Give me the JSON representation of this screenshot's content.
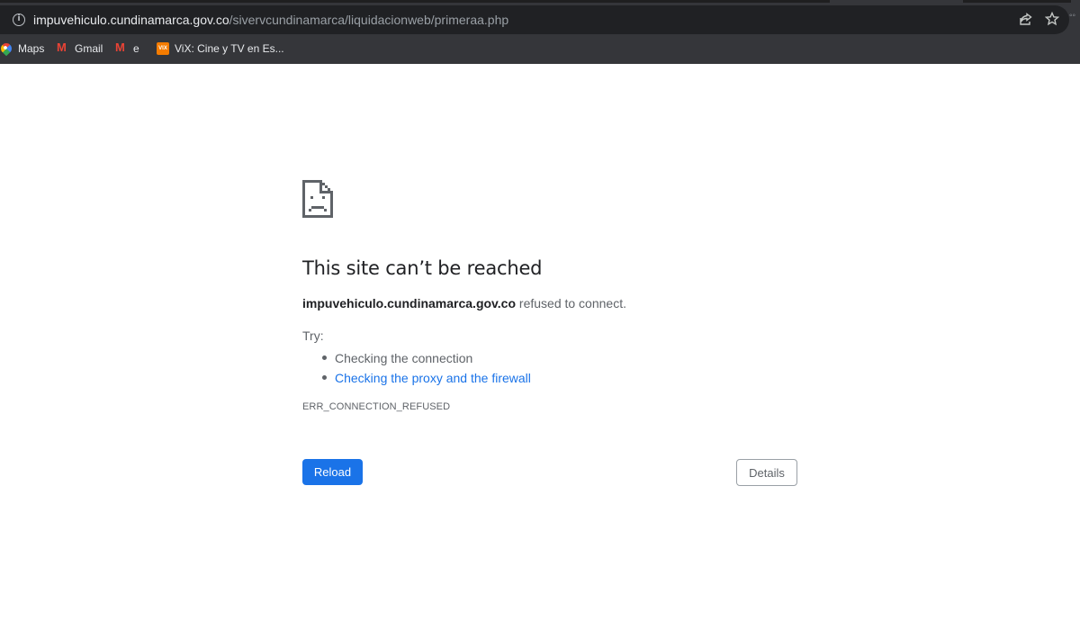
{
  "browser": {
    "omnibox": {
      "host": "impuvehiculo.cundinamarca.gov.co",
      "path": "/sivervcundinamarca/liquidacionweb/primeraa.php"
    },
    "icons": {
      "info": "info-icon",
      "share": "share-icon",
      "star": "star-icon"
    },
    "bookmarks": [
      {
        "label": "Maps",
        "icon": "maps-icon"
      },
      {
        "label": "Gmail",
        "icon": "gmail-icon"
      },
      {
        "label": "e",
        "icon": "gmail-icon"
      },
      {
        "label": "ViX: Cine y TV en Es...",
        "icon": "vix-icon",
        "icon_text": "VIX"
      }
    ]
  },
  "error_page": {
    "icon": "sad-page-icon",
    "title": "This site can’t be reached",
    "host": "impuvehiculo.cundinamarca.gov.co",
    "message": " refused to connect.",
    "try_label": "Try:",
    "suggestions": [
      "Checking the connection",
      "Checking the proxy and the firewall"
    ],
    "error_code": "ERR_CONNECTION_REFUSED",
    "reload_label": "Reload",
    "details_label": "Details"
  },
  "colors": {
    "accent": "#1a73e8",
    "chrome_bg": "#35363a",
    "omnibox_bg": "#202124",
    "text_primary": "#202124",
    "text_secondary": "#5f6368"
  }
}
